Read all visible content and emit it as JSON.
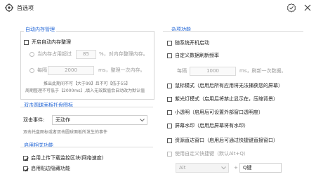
{
  "window": {
    "title": "首选项"
  },
  "auto_clean": {
    "group_title": "自动内存管理",
    "enable_label": "开启自动内存整理",
    "threshold_prefix": "当内存占用超过",
    "threshold_value": "85",
    "threshold_suffix": "%，对内存整理内存。",
    "interval_prefix": "每隔",
    "interval_value": "2000",
    "interval_suffix": "ms，整理一次内存。",
    "note1": "推出此期间不可【大于99】且不可【低于55】",
    "note2": "周期整理不可低于【2000ms】,填入无效数值会自动改为默认值"
  },
  "double_click": {
    "group_title": "双击圆球面板托盘图标",
    "event_label": "双击事件:",
    "event_value": "无动作",
    "note": "双击托盘图标或者双击圆球面板所发生的事件"
  },
  "startup": {
    "group_title": "启用相关功能",
    "item1": "启用上传下载监控区块(网络速度)",
    "item2": "启用贴边隐藏功能"
  },
  "misc": {
    "group_title": "杂项功能",
    "autostart": "随系统开机启动",
    "custom_refresh": "自定义数据刷新频率",
    "refresh_prefix": "每隔",
    "refresh_value": "1000",
    "refresh_suffix": "ms，刷新一次数据。",
    "passthrough": "鼠标模式（启用后所有应用将无法捕获您的屏幕）",
    "corner": "紫光灯模式（启用后将禁止显示在，压缩背景）",
    "small_window": "小透明（启用后可设置外部窗口透明度）",
    "hide_screen": "屏幕水印（启用后屏幕将有水印）",
    "hotkey_restore": "资源直达窗口（启用后可通过快捷键直接窗口）",
    "custom_hotkey": "使用自定义快捷键（默认Alt+Q）",
    "modifier_value": "Alt",
    "plus": "+",
    "key_value": "Q键"
  },
  "icons": [
    "settings-app-icon",
    "verify-icon",
    "close-icon",
    "check-icon",
    "dropdown-arrow-icon"
  ],
  "colors": {
    "group_title": "#1e63d6",
    "border": "#d6d6d6"
  }
}
